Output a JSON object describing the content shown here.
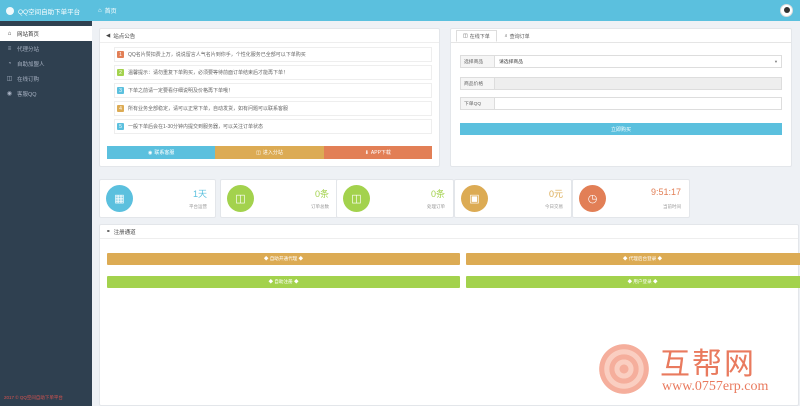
{
  "app": {
    "title": "QQ空间自助下单平台",
    "header_nav": "首页"
  },
  "colors": {
    "primary": "#5bc0de",
    "sidebar": "#2f4050",
    "orange": "#e27f56",
    "gold": "#dcab54",
    "green": "#a3d24d",
    "teal": "#5bc0de"
  },
  "sidebar": {
    "items": [
      {
        "icon": "home-icon",
        "glyph": "⌂",
        "label": "网站首页"
      },
      {
        "icon": "list-icon",
        "glyph": "≡",
        "label": "代理分站"
      },
      {
        "icon": "user-icon",
        "glyph": "◔",
        "label": "自助加盟人"
      },
      {
        "icon": "cart-icon",
        "glyph": "◫",
        "label": "在线订购"
      },
      {
        "icon": "qq-icon",
        "glyph": "◉",
        "label": "客服QQ"
      }
    ],
    "footer": "2017 © QQ空间自助下单平台"
  },
  "notice": {
    "title": "站点公告",
    "items": [
      {
        "n": "1",
        "color": "#e27f56",
        "text": "QQ名片赞扣费上万，说说留言人气名片到你手，个性化服务已全部可以下单购买"
      },
      {
        "n": "2",
        "color": "#a3d24d",
        "text": "温馨提示：请勿重复下单购买，必须要等待前面订单结束后才能再下单！"
      },
      {
        "n": "3",
        "color": "#5bc0de",
        "text": "下单之前请一定要看仔细说明及价格再下单哦！"
      },
      {
        "n": "4",
        "color": "#dcab54",
        "text": "所有业务全部稳定，请可以正常下单，自动发货，如有问题可以联系客服"
      },
      {
        "n": "5",
        "color": "#5bc0de",
        "text": "一般下单后会在1-30分钟内提交到服务器，可以关注订单状态"
      }
    ],
    "buttons": [
      {
        "icon": "user-icon",
        "glyph": "◉",
        "label": "联系客服",
        "color": "#5bc0de"
      },
      {
        "icon": "cart-icon",
        "glyph": "◫",
        "label": "进入分站",
        "color": "#dcab54"
      },
      {
        "icon": "download-icon",
        "glyph": "⬇",
        "label": "APP下载",
        "color": "#e27f56"
      }
    ]
  },
  "order": {
    "tabs": [
      {
        "icon": "cart-icon",
        "glyph": "◫",
        "label": "在线下单"
      },
      {
        "icon": "search-icon",
        "glyph": "⌕",
        "label": "查询订单"
      }
    ],
    "fields": [
      {
        "label": "选择商品",
        "value": "请选择商品"
      },
      {
        "label": "商品价格",
        "value": ""
      },
      {
        "label": "下单QQ",
        "value": ""
      }
    ],
    "submit": "立即购买"
  },
  "stats": [
    {
      "icon": "calendar-icon",
      "glyph": "▦",
      "value": "1天",
      "label": "平台运营",
      "color": "#5bc0de"
    },
    {
      "icon": "cart-icon",
      "glyph": "◫",
      "value": "0条",
      "label": "订单总数",
      "color": "#a3d24d"
    },
    {
      "icon": "cart-icon",
      "glyph": "◫",
      "value": "0条",
      "label": "处理订单",
      "color": "#a3d24d"
    },
    {
      "icon": "money-icon",
      "glyph": "▣",
      "value": "0元",
      "label": "今日交易",
      "color": "#dcab54"
    },
    {
      "icon": "clock-icon",
      "glyph": "◷",
      "value": "9:51:17",
      "label": "当前时间",
      "color": "#e27f56"
    }
  ],
  "shortcuts": {
    "title": "注册通道",
    "buttons": [
      {
        "label": "◆ 自助开通代理 ◆",
        "color": "#dcab54"
      },
      {
        "label": "◆ 代理后台登录 ◆",
        "color": "#dcab54"
      },
      {
        "label": "◆ 自助注册 ◆",
        "color": "#a3d24d"
      },
      {
        "label": "◆ 用户登录 ◆",
        "color": "#a3d24d"
      }
    ]
  },
  "watermark": {
    "text": "互帮网",
    "url": "www.0757erp.com"
  }
}
